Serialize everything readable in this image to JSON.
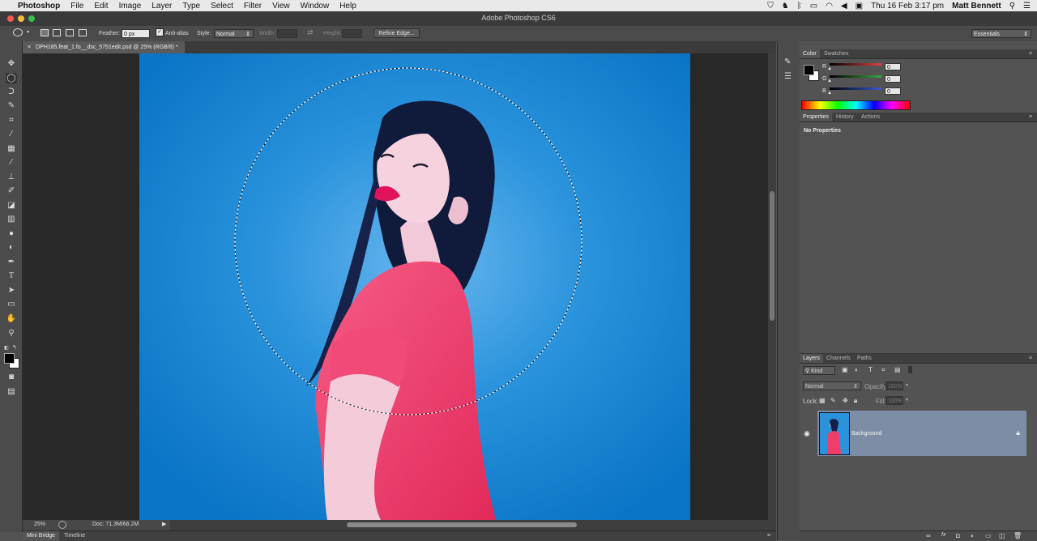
{
  "menubar": {
    "apple": "",
    "app_name": "Photoshop",
    "items": [
      "File",
      "Edit",
      "Image",
      "Layer",
      "Type",
      "Select",
      "Filter",
      "View",
      "Window",
      "Help"
    ],
    "datetime": "Thu 16 Feb  3:17 pm",
    "user": "Matt Bennett"
  },
  "window": {
    "title": "Adobe Photoshop CS6"
  },
  "options": {
    "feather_label": "Feather:",
    "feather_value": "0 px",
    "antialias_label": "Anti-alias",
    "antialias_checked": true,
    "style_label": "Style:",
    "style_value": "Normal",
    "width_label": "Width:",
    "height_label": "Height:",
    "refine_edge_label": "Refine Edge...",
    "workspace": "Essentials"
  },
  "document": {
    "tab_label": "DPH185.feat_1.fo__dsc_5751edit.psd @ 25% (RGB/8) *",
    "zoom": "25%",
    "doc_size": "Doc: 71.3M/66.2M"
  },
  "bottom_tabs": [
    "Mini Bridge",
    "Timeline"
  ],
  "color_panel": {
    "tabs": [
      "Color",
      "Swatches"
    ],
    "r_label": "R",
    "g_label": "G",
    "b_label": "B",
    "r": "0",
    "g": "0",
    "b": "0",
    "colors": {
      "r": "#e24040",
      "g": "#3aa544",
      "b": "#3b5bd0"
    }
  },
  "properties_panel": {
    "tabs": [
      "Properties",
      "History",
      "Actions"
    ],
    "message": "No Properties"
  },
  "layers_panel": {
    "tabs": [
      "Layers",
      "Channels",
      "Paths"
    ],
    "filter_label": "Kind",
    "blend_mode": "Normal",
    "opacity_label": "Opacity:",
    "opacity_value": "100%",
    "lock_label": "Lock:",
    "fill_label": "Fill:",
    "fill_value": "100%",
    "layers": [
      {
        "name": "Background",
        "visible": true,
        "locked": true
      }
    ]
  },
  "colors": {
    "canvas_bg": "#1b88d4",
    "dress": "#f23d6b",
    "layer_selected": "#7d8da6"
  }
}
